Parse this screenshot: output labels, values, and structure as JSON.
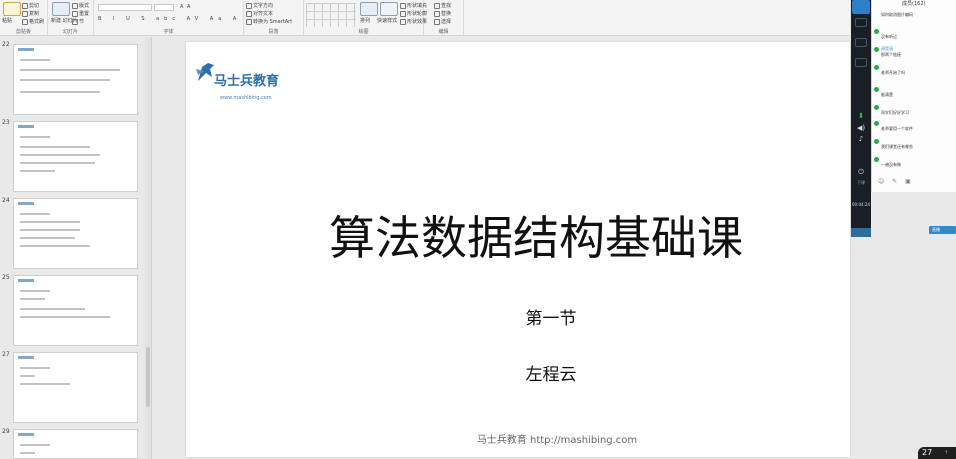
{
  "ribbon": {
    "clipboard": {
      "paste": "粘贴",
      "cut": "剪切",
      "copy": "复制",
      "format_painter": "格式刷",
      "label": "剪贴板"
    },
    "slides": {
      "new_slide": "新建\n幻灯片",
      "layout": "版式",
      "reset": "重置",
      "section": "节",
      "label": "幻灯片"
    },
    "font": {
      "label": "字体"
    },
    "paragraph": {
      "text_direction": "文字方向",
      "align_text": "对齐文本",
      "convert_smartart": "转换为 SmartArt",
      "label": "段落"
    },
    "drawing": {
      "arrange": "排列",
      "quick_styles": "快速样式",
      "shape_fill": "形状填充",
      "shape_outline": "形状轮廓",
      "shape_effects": "形状效果",
      "label": "绘图"
    },
    "editing": {
      "find": "查找",
      "replace": "替换",
      "select": "选择",
      "label": "编辑"
    }
  },
  "slide_panel": {
    "thumbnails": [
      {
        "number": "22"
      },
      {
        "number": "23"
      },
      {
        "number": "24"
      },
      {
        "number": "25"
      },
      {
        "number": "27"
      },
      {
        "number": "29"
      }
    ]
  },
  "slide": {
    "logo_text": "马士兵教育",
    "logo_url": "www.mashibing.com",
    "title": "算法数据结构基础课",
    "subtitle": "第一节",
    "author": "左程云",
    "footer": "马士兵教育 http://mashibing.com"
  },
  "live_toolbar": {
    "download_label": "下课",
    "time": "00:04:24"
  },
  "chat": {
    "header": "成员(162)",
    "messages": [
      {
        "user": "",
        "text": "如何取消图片编码"
      },
      {
        "user": "",
        "text": "没有听过"
      },
      {
        "user": "谌昊清",
        "text": "那两个链接"
      },
      {
        "user": "",
        "text": "老师开始了吗"
      },
      {
        "user": "",
        "text": "能清楚"
      },
      {
        "user": "",
        "text": "同学们好好学习"
      },
      {
        "user": "",
        "text": "老师要用一个软件"
      },
      {
        "user": "",
        "text": "我们课堂还有哪些"
      },
      {
        "user": "",
        "text": "一遍没有做"
      }
    ],
    "tools": "☺ ✎ ▣"
  },
  "side_button": "直播",
  "tray": {
    "number": "27",
    "indicator": "↑"
  },
  "colors": {
    "brand_blue": "#2d6fa6",
    "live_dark": "#1a1f26",
    "accent": "#2f8bd0"
  }
}
